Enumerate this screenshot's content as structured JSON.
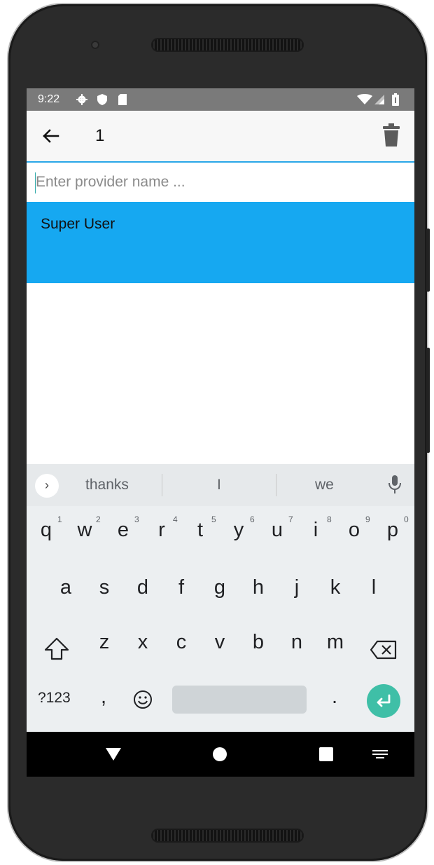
{
  "status_bar": {
    "time": "9:22"
  },
  "app_bar": {
    "title": "1"
  },
  "search": {
    "placeholder": "Enter provider name ..."
  },
  "list": {
    "items": [
      {
        "label": "Super User"
      }
    ]
  },
  "keyboard": {
    "suggestions": [
      "thanks",
      "I",
      "we"
    ],
    "row1": [
      {
        "key": "q",
        "hint": "1"
      },
      {
        "key": "w",
        "hint": "2"
      },
      {
        "key": "e",
        "hint": "3"
      },
      {
        "key": "r",
        "hint": "4"
      },
      {
        "key": "t",
        "hint": "5"
      },
      {
        "key": "y",
        "hint": "6"
      },
      {
        "key": "u",
        "hint": "7"
      },
      {
        "key": "i",
        "hint": "8"
      },
      {
        "key": "o",
        "hint": "9"
      },
      {
        "key": "p",
        "hint": "0"
      }
    ],
    "row2": [
      "a",
      "s",
      "d",
      "f",
      "g",
      "h",
      "j",
      "k",
      "l"
    ],
    "row3": [
      "z",
      "x",
      "c",
      "v",
      "b",
      "n",
      "m"
    ],
    "symbols_key": "?123",
    "comma_key": ",",
    "period_key": ".",
    "accent_color": "#3fbfa7"
  },
  "colors": {
    "list_highlight": "#16a8f1",
    "app_bar_underline": "#2aa7e8"
  },
  "icons": {
    "status": [
      "settings-icon",
      "shield-icon",
      "sd-card-icon",
      "wifi-icon",
      "signal-icon",
      "battery-icon"
    ],
    "app_bar": [
      "back-arrow-icon",
      "trash-icon"
    ],
    "keyboard": [
      "chevron-right-icon",
      "mic-icon",
      "shift-icon",
      "backspace-icon",
      "emoji-icon",
      "enter-icon"
    ],
    "nav": [
      "nav-back-icon",
      "nav-home-icon",
      "nav-recent-icon",
      "keyboard-switch-icon"
    ]
  }
}
